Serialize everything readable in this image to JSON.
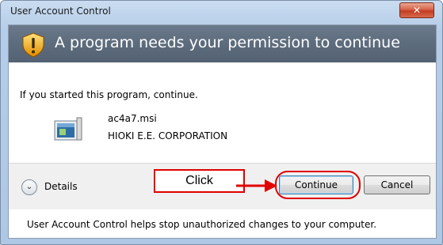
{
  "window": {
    "title": "User Account Control",
    "close_label": "✕"
  },
  "banner": {
    "text": "A program needs your permission to continue",
    "icon": "uac-shield-icon"
  },
  "content": {
    "intro": "If you started this program, continue.",
    "program_name": "ac4a7.msi",
    "publisher": "HIOKI E.E. CORPORATION",
    "program_icon": "installer-icon"
  },
  "footer": {
    "details_label": "Details",
    "continue_label": "Continue",
    "cancel_label": "Cancel",
    "help_text": "User Account Control helps stop unauthorized changes to your computer."
  },
  "annotation": {
    "click_label": "Click",
    "color": "#e00000"
  },
  "colors": {
    "banner": "#5d6c7d",
    "titlebar": "#b6cde8"
  }
}
